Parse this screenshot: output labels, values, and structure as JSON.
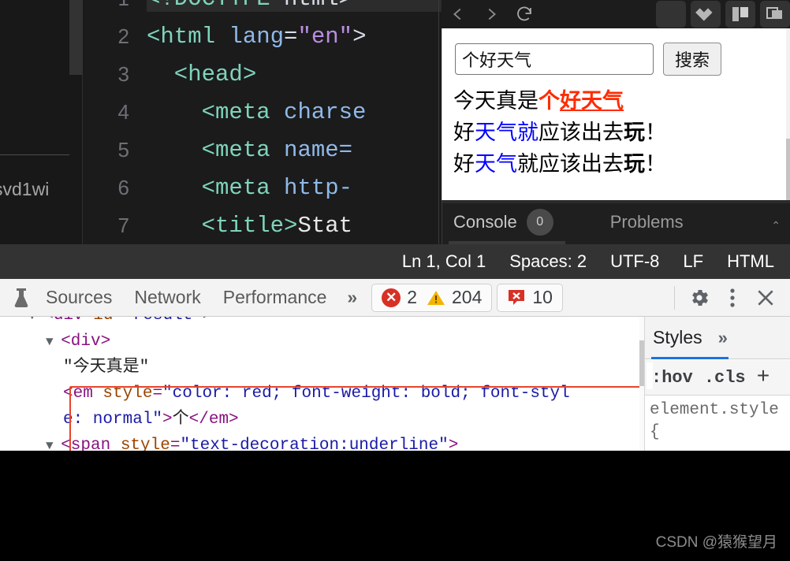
{
  "editor": {
    "left_fragment_text": "svd1wi",
    "lines": [
      {
        "no": "1",
        "highlighted": true,
        "segments": [
          {
            "t": "<!DOCTYPE",
            "c": "tag"
          },
          {
            "t": " html>",
            "c": "punc"
          }
        ]
      },
      {
        "no": "2",
        "highlighted": false,
        "segments": [
          {
            "t": "<html",
            "c": "tag"
          },
          {
            "t": " lang",
            "c": "attr"
          },
          {
            "t": "=",
            "c": "punc"
          },
          {
            "t": "\"en\"",
            "c": "val"
          },
          {
            "t": ">",
            "c": "punc"
          }
        ]
      },
      {
        "no": "3",
        "highlighted": false,
        "segments": [
          {
            "t": "  <head>",
            "c": "tag"
          }
        ]
      },
      {
        "no": "4",
        "highlighted": false,
        "segments": [
          {
            "t": "    <meta",
            "c": "tag"
          },
          {
            "t": " charse",
            "c": "attr"
          }
        ]
      },
      {
        "no": "5",
        "highlighted": false,
        "segments": [
          {
            "t": "    <meta",
            "c": "tag"
          },
          {
            "t": " name=",
            "c": "attr"
          }
        ]
      },
      {
        "no": "6",
        "highlighted": false,
        "segments": [
          {
            "t": "    <meta",
            "c": "tag"
          },
          {
            "t": " http-",
            "c": "attr"
          }
        ]
      },
      {
        "no": "7",
        "highlighted": false,
        "segments": [
          {
            "t": "    <title>",
            "c": "tag"
          },
          {
            "t": "Stat",
            "c": "txt"
          }
        ]
      }
    ],
    "status_bar": {
      "cursor": "Ln 1, Col 1",
      "indent": "Spaces: 2",
      "encoding": "UTF-8",
      "eol": "LF",
      "language": "HTML"
    }
  },
  "browser": {
    "toolbar": {
      "back_icon": "chevron-left-icon",
      "forward_icon": "chevron-right-icon",
      "reload_icon": "reload-icon",
      "blank_icon": "blank-panel-icon",
      "extensions_icon": "diamond-cluster-icon",
      "layout_icon": "split-layout-icon",
      "windows_icon": "copy-windows-icon"
    },
    "page": {
      "search_value": "个好天气",
      "search_placeholder": "",
      "search_button": "搜索",
      "results": [
        {
          "id": "result-line-1",
          "parts": [
            {
              "text": "今天真是",
              "style": "plain"
            },
            {
              "text": "个",
              "style": "em-red"
            },
            {
              "text": "好天气",
              "style": "em-red-underline"
            }
          ]
        },
        {
          "id": "result-line-2",
          "parts": [
            {
              "text": "好",
              "style": "plain"
            },
            {
              "text": "天气就",
              "style": "blue"
            },
            {
              "text": "应该出去",
              "style": "plain"
            },
            {
              "text": "玩",
              "style": "bold"
            },
            {
              "text": "！",
              "style": "plain"
            }
          ]
        },
        {
          "id": "result-line-3",
          "parts": [
            {
              "text": "好",
              "style": "plain"
            },
            {
              "text": "天气",
              "style": "blue"
            },
            {
              "text": "就应该出去",
              "style": "plain"
            },
            {
              "text": "玩",
              "style": "bold"
            },
            {
              "text": "！",
              "style": "plain"
            }
          ]
        }
      ]
    },
    "drawer": {
      "console_tab": "Console",
      "console_count": "0",
      "problems_tab": "Problems",
      "collapse_icon": "chevron-up-icon"
    }
  },
  "devtools": {
    "flask_icon": "flask-icon",
    "tabs": [
      {
        "label": "Sources"
      },
      {
        "label": "Network"
      },
      {
        "label": "Performance"
      }
    ],
    "more_tabs": "»",
    "errors_pill": {
      "error_icon": "error-circle-icon",
      "error_count": "2",
      "warn_icon": "warning-triangle-icon",
      "warn_count": "204"
    },
    "issues_pill": {
      "issue_icon": "issue-square-icon",
      "issue_count": "10"
    },
    "settings_icon": "gear-icon",
    "kebab_icon": "more-vertical-icon",
    "close_icon": "close-icon",
    "dom_tree": [
      {
        "indent": 0,
        "triangle": true,
        "segments": [
          {
            "t": "<",
            "c": "n-tag"
          },
          {
            "t": "div",
            "c": "n-tag"
          },
          {
            "t": " id",
            "c": "n-attr"
          },
          {
            "t": "=",
            "c": "n-tag"
          },
          {
            "t": "\"result\"",
            "c": "n-val"
          },
          {
            "t": ">",
            "c": "n-tag"
          }
        ]
      },
      {
        "indent": 1,
        "triangle": true,
        "segments": [
          {
            "t": "<div>",
            "c": "n-tag"
          }
        ]
      },
      {
        "indent": 2,
        "triangle": false,
        "segments": [
          {
            "t": "\"今天真是\"",
            "c": "n-text"
          }
        ]
      },
      {
        "indent": 2,
        "triangle": false,
        "segments": [
          {
            "t": "<em",
            "c": "n-tag"
          },
          {
            "t": " style",
            "c": "n-attr"
          },
          {
            "t": "=",
            "c": "n-tag"
          },
          {
            "t": "\"color: red; font-weight: bold; font-styl",
            "c": "n-val"
          }
        ]
      },
      {
        "indent": 2,
        "triangle": false,
        "segments": [
          {
            "t": "e: normal\"",
            "c": "n-val"
          },
          {
            "t": ">",
            "c": "n-tag"
          },
          {
            "t": "个",
            "c": "n-text"
          },
          {
            "t": "</em>",
            "c": "n-tag"
          }
        ]
      },
      {
        "indent": 1,
        "triangle": true,
        "segments": [
          {
            "t": "<span",
            "c": "n-tag"
          },
          {
            "t": " style",
            "c": "n-attr"
          },
          {
            "t": "=",
            "c": "n-tag"
          },
          {
            "t": "\"text-decoration:underline\"",
            "c": "n-val"
          },
          {
            "t": ">",
            "c": "n-tag"
          }
        ]
      }
    ],
    "styles": {
      "tab_label": "Styles",
      "more_icon": "»",
      "hov_label": ":hov",
      "cls_label": ".cls",
      "add_rule_icon": "+",
      "rule_text": "element.style {"
    }
  },
  "footer": {
    "watermark": "CSDN @猿猴望月"
  }
}
